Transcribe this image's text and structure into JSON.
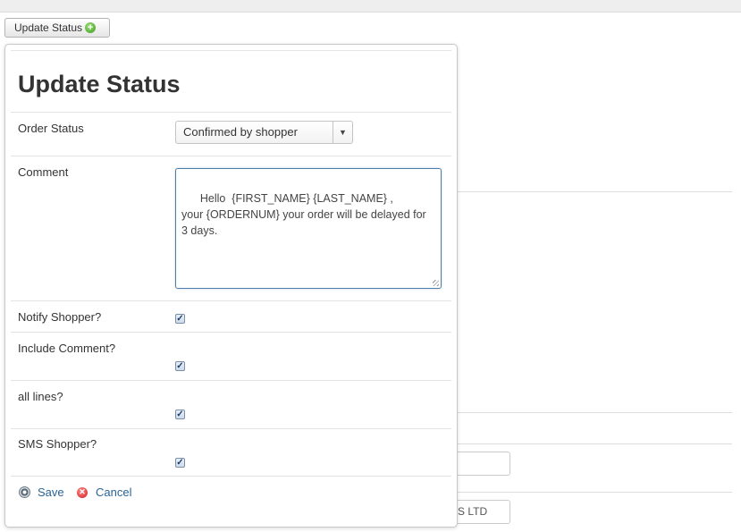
{
  "toolbar": {
    "update_status_label": "Update Status"
  },
  "background": {
    "input2_text": "S LTD"
  },
  "modal": {
    "title": "Update Status",
    "order_status": {
      "label": "Order Status",
      "selected": "Confirmed by shopper"
    },
    "comment": {
      "label": "Comment",
      "value": "Hello  {FIRST_NAME} {LAST_NAME} ,\nyour {ORDERNUM} your order will be delayed for 3 days."
    },
    "checkboxes": [
      {
        "label": "Notify Shopper?",
        "checked": true
      },
      {
        "label": "Include Comment?",
        "checked": true
      },
      {
        "label": "all lines?",
        "checked": true
      },
      {
        "label": "SMS Shopper?",
        "checked": true
      }
    ],
    "actions": {
      "save": "Save",
      "cancel": "Cancel"
    }
  },
  "icons": {
    "add": "add-icon",
    "select_arrow": "chevron-down-icon",
    "save": "save-icon",
    "cancel": "cancel-icon"
  }
}
